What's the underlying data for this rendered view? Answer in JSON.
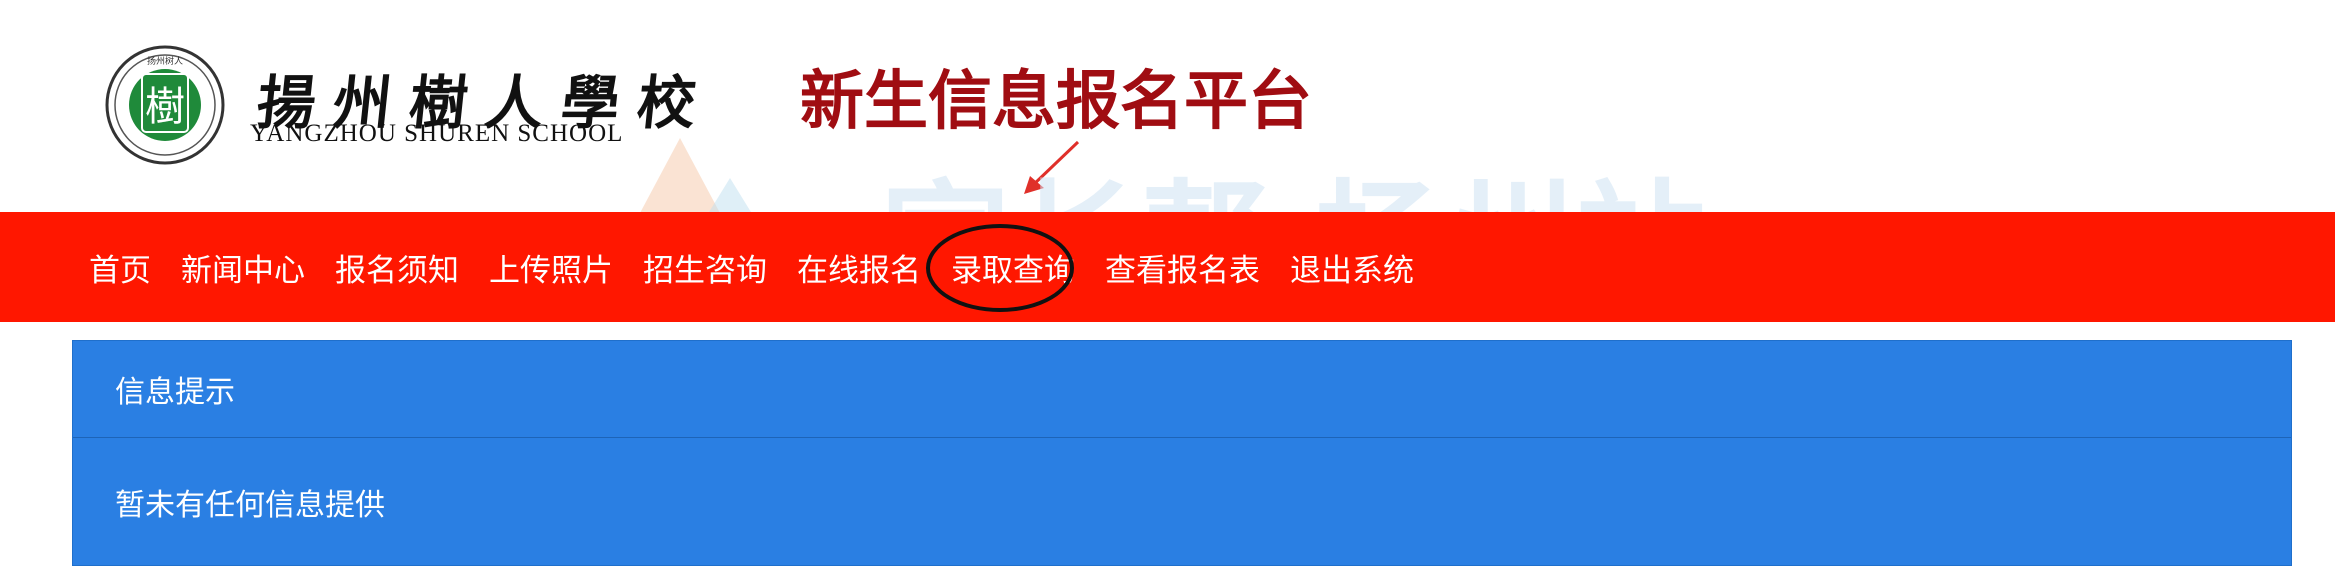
{
  "header": {
    "school_name_cn": "揚州樹人學校",
    "school_name_en": "YANGZHOU  SHUREN  SCHOOL",
    "platform_title": "新生信息报名平台",
    "seal_text": "扬州树人",
    "seal_glyph": "樹"
  },
  "watermark": {
    "text": "家长帮 扬州站"
  },
  "nav": {
    "items": [
      {
        "label": "首页"
      },
      {
        "label": "新闻中心"
      },
      {
        "label": "报名须知"
      },
      {
        "label": "上传照片"
      },
      {
        "label": "招生咨询"
      },
      {
        "label": "在线报名"
      },
      {
        "label": "录取查询"
      },
      {
        "label": "查看报名表"
      },
      {
        "label": "退出系统"
      }
    ]
  },
  "panel": {
    "heading": "信息提示",
    "body": "暂未有任何信息提供"
  },
  "colors": {
    "nav_bg": "#ff1700",
    "title_red": "#a00d12",
    "panel_blue": "#2a7fe3",
    "seal_green": "#1f8a3a"
  },
  "icons": [
    "school-seal-logo",
    "annotation-arrow",
    "annotation-circle",
    "watermark-logo"
  ]
}
